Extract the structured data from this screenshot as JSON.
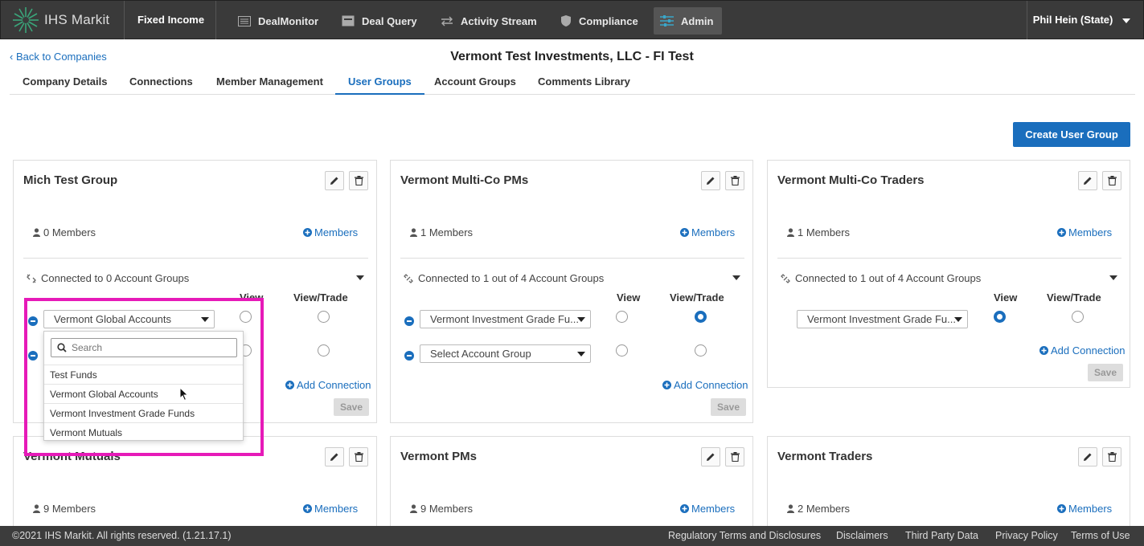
{
  "header": {
    "brand": "IHS Markit",
    "product": "Fixed Income",
    "nav": [
      {
        "label": "DealMonitor",
        "icon": "list-icon"
      },
      {
        "label": "Deal Query",
        "icon": "inbox-icon"
      },
      {
        "label": "Activity Stream",
        "icon": "exchange-icon"
      },
      {
        "label": "Compliance",
        "icon": "shield-icon"
      },
      {
        "label": "Admin",
        "icon": "sliders-icon",
        "active": true
      }
    ],
    "user": "Phil Hein (State)"
  },
  "back_link": "Back to Companies",
  "page_title": "Vermont Test Investments, LLC - FI Test",
  "tabs": [
    {
      "label": "Company Details"
    },
    {
      "label": "Connections"
    },
    {
      "label": "Member Management"
    },
    {
      "label": "User Groups",
      "active": true
    },
    {
      "label": "Account Groups"
    },
    {
      "label": "Comments Library"
    }
  ],
  "create_button": "Create User Group",
  "labels": {
    "members_link": "Members",
    "view": "View",
    "view_trade": "View/Trade",
    "add_connection": "Add Connection",
    "save": "Save"
  },
  "groups": [
    {
      "name": "Mich Test Group",
      "members": "0 Members",
      "connected": "Connected to 0 Account Groups",
      "rows": [
        {
          "select": "Vermont Global Accounts",
          "view": false,
          "view_trade": false
        },
        {
          "select": "",
          "view": false,
          "view_trade": false
        }
      ]
    },
    {
      "name": "Vermont Multi-Co PMs",
      "members": "1 Members",
      "connected": "Connected to 1 out of 4 Account Groups",
      "rows": [
        {
          "select": "Vermont Investment Grade Fu...",
          "view": false,
          "view_trade": true
        },
        {
          "select": "Select Account Group",
          "view": false,
          "view_trade": false
        }
      ]
    },
    {
      "name": "Vermont Multi-Co Traders",
      "members": "1 Members",
      "connected": "Connected to 1 out of 4 Account Groups",
      "rows": [
        {
          "select": "Vermont Investment Grade Fu...",
          "view": true,
          "view_trade": false
        }
      ]
    },
    {
      "name": "Vermont Mutuals",
      "members": "9 Members"
    },
    {
      "name": "Vermont PMs",
      "members": "9 Members"
    },
    {
      "name": "Vermont Traders",
      "members": "2 Members"
    }
  ],
  "dropdown": {
    "search_placeholder": "Search",
    "options": [
      "Test Funds",
      "Vermont Global Accounts",
      "Vermont Investment Grade Funds",
      "Vermont Mutuals"
    ]
  },
  "footer": {
    "copyright": "©2021 IHS Markit. All rights reserved. (1.21.17.1)",
    "links": [
      "Regulatory Terms and Disclosures",
      "Disclaimers",
      "Third Party Data",
      "Privacy Policy",
      "Terms of Use"
    ]
  }
}
